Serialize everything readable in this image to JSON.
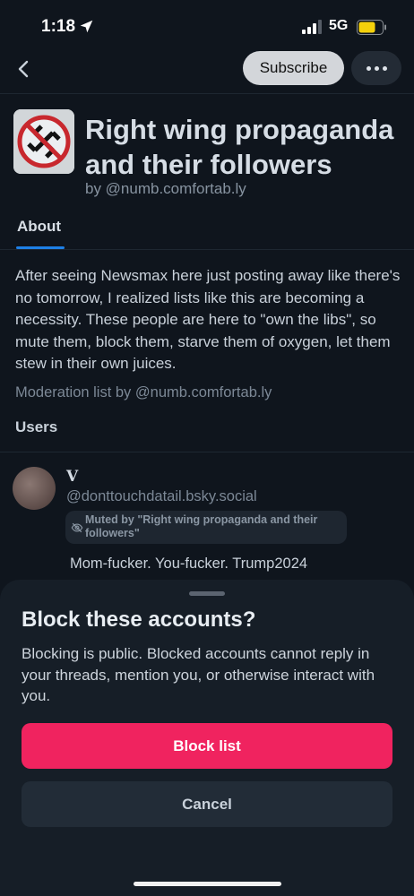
{
  "status_bar": {
    "time": "1:18",
    "network": "5G"
  },
  "nav": {
    "subscribe_label": "Subscribe"
  },
  "list": {
    "title": "Right wing propaganda and their followers",
    "byline": "by @numb.comfortab.ly"
  },
  "tabs": [
    {
      "label": "About"
    }
  ],
  "about": {
    "description": "After seeing Newsmax here just posting away like there's no tomorrow, I realized lists like this are becoming a necessity. These people are here to \"own the libs\", so mute them, block them, starve them of oxygen, let them stew in their own juices.",
    "moderation_line": "Moderation list by @numb.comfortab.ly",
    "users_heading": "Users"
  },
  "users": [
    {
      "name": "V",
      "handle": "@donttouchdatail.bsky.social",
      "muted_label": "Muted by \"Right wing propaganda and their followers\"",
      "bio": "Mom-fucker. You-fucker. Trump2024"
    }
  ],
  "sheet": {
    "title": "Block these accounts?",
    "body": "Blocking is public. Blocked accounts cannot reply in your threads, mention you, or otherwise interact with you.",
    "confirm_label": "Block list",
    "cancel_label": "Cancel"
  },
  "colors": {
    "accent": "#1e80e6",
    "danger": "#f0235f",
    "background": "#0f151d"
  },
  "icons": [
    "location-arrow-icon",
    "signal-icon",
    "battery-icon",
    "back-chevron-icon",
    "ellipsis-icon",
    "list-avatar-icon",
    "muted-eye-slash-icon"
  ]
}
